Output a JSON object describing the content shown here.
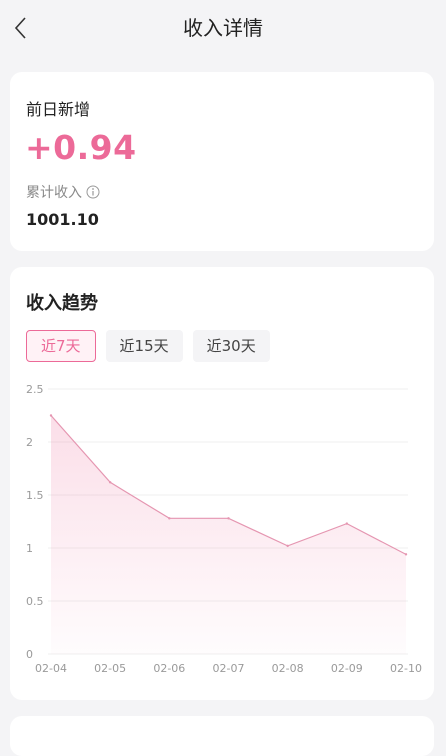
{
  "header": {
    "title": "收入详情"
  },
  "summary": {
    "yesterday_label": "前日新增",
    "yesterday_value": "+0.94",
    "cumulative_label": "累计收入",
    "cumulative_value": "1001.10"
  },
  "trend": {
    "title": "收入趋势",
    "tabs": [
      {
        "label": "近7天",
        "active": true
      },
      {
        "label": "近15天",
        "active": false
      },
      {
        "label": "近30天",
        "active": false
      }
    ]
  },
  "colors": {
    "accent": "#ec6a98",
    "background": "#f4f4f6"
  },
  "chart_data": {
    "type": "area",
    "categories": [
      "02-04",
      "02-05",
      "02-06",
      "02-07",
      "02-08",
      "02-09",
      "02-10"
    ],
    "values": [
      2.25,
      1.62,
      1.28,
      1.28,
      1.02,
      1.23,
      0.94
    ],
    "ylim": [
      0,
      2.5
    ],
    "yticks": [
      "0",
      "0.5",
      "1",
      "1.5",
      "2",
      "2.5"
    ],
    "grid": true,
    "title": "",
    "xlabel": "",
    "ylabel": ""
  }
}
